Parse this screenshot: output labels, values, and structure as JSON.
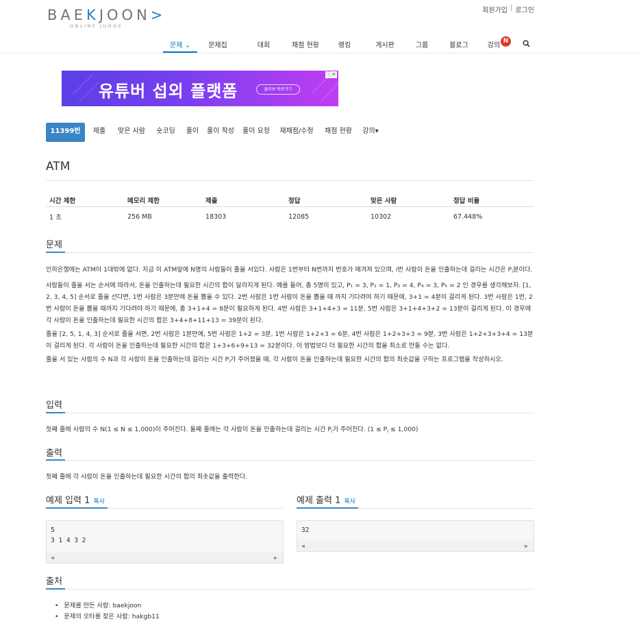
{
  "logo": {
    "main_pre": "BAE",
    "main_k": "K",
    "main_post": "JOON",
    "main_arrow": ">",
    "sub": "ONLINE JUDGE"
  },
  "top_links": {
    "signup": "회원가입",
    "separator": "|",
    "login": "로그인"
  },
  "nav": {
    "items": [
      {
        "label": "문제 ⌄",
        "active": true
      },
      {
        "label": "문제집"
      },
      {
        "label": "대회"
      },
      {
        "label": "채점 현황"
      },
      {
        "label": "랭킹"
      },
      {
        "label": "게시판"
      },
      {
        "label": "그룹"
      },
      {
        "label": "블로그"
      },
      {
        "label": "강의"
      }
    ],
    "badge": "N",
    "search_icon": "search-icon"
  },
  "ad": {
    "text": "유튜버 섭외 플랫폼",
    "button": "둘러보 바로가기",
    "close": "ⓘ✕"
  },
  "problem_tabs": [
    "11399번",
    "제출",
    "맞은 사람",
    "숏코딩",
    "풀이",
    "풀이 작성",
    "풀이 요청",
    "재채점/수정",
    "채점 현황",
    "강의▾"
  ],
  "problem": {
    "title": "ATM",
    "stats_headers": [
      "시간 제한",
      "메모리 제한",
      "제출",
      "정답",
      "맞은 사람",
      "정답 비율"
    ],
    "stats_values": [
      "1 초",
      "256 MB",
      "18303",
      "12085",
      "10302",
      "67.448%"
    ]
  },
  "sections": {
    "problem_title": "문제",
    "input_title": "입력",
    "output_title": "출력",
    "sample_input_title": "예제 입력 1",
    "sample_output_title": "예제 출력 1",
    "copy": "복사",
    "source_title": "출처"
  },
  "description": {
    "p1a": "인하은행에는 ATM이 1대밖에 없다. 지금 이 ATM앞에 N명의 사람들이 줄을 서있다. 사람은 1번부터 N번까지 번호가 매겨져 있으며, i번 사람이 돈을 인출하는데 걸리는 시간은 P",
    "p1sub": "i",
    "p1b": "분이다.",
    "p2": "사람들이 줄을 서는 순서에 따라서, 돈을 인출하는데 필요한 시간의 합이 달라지게 된다. 예를 들어, 총 5명이 있고, P₁ = 3, P₂ = 1, P₃ = 4, P₄ = 3, P₅ = 2 인 경우를 생각해보자. [1, 2, 3, 4, 5] 순서로 줄을 선다면, 1번 사람은 3분만에 돈을 뽑을 수 있다. 2번 사람은 1번 사람이 돈을 뽑을 때 까지 기다려야 하기 때문에, 3+1 = 4분이 걸리게 된다. 3번 사람은 1번, 2번 사람이 돈을 뽑을 때까지 기다려야 하기 때문에, 총 3+1+4 = 8분이 필요하게 된다. 4번 사람은 3+1+4+3 = 11분, 5번 사람은 3+1+4+3+2 = 13분이 걸리게 된다. 이 경우에 각 사람이 돈을 인출하는데 필요한 시간의 합은 3+4+8+11+13 = 39분이 된다.",
    "p3": "줄을 [2, 5, 1, 4, 3] 순서로 줄을 서면, 2번 사람은 1분만에, 5번 사람은 1+2 = 3분, 1번 사람은 1+2+3 = 6분, 4번 사람은 1+2+3+3 = 9분, 3번 사람은 1+2+3+3+4 = 13분이 걸리게 된다. 각 사람이 돈을 인출하는데 필요한 시간의 합은 1+3+6+9+13 = 32분이다. 이 방법보다 더 필요한 시간의 합을 최소로 만들 수는 없다.",
    "p4a": "줄을 서 있는 사람의 수 N과 각 사람이 돈을 인출하는데 걸리는 시간 P",
    "p4sub": "i",
    "p4b": "가 주어졌을 때, 각 사람이 돈을 인출하는데 필요한 시간의 합의 최솟값을 구하는 프로그램을 작성하시오."
  },
  "input_desc": {
    "a": "첫째 줄에 사람의 수 N(1 ≤ N ≤ 1,000)이 주어진다. 둘째 줄에는 각 사람이 돈을 인출하는데 걸리는 시간 P",
    "sub1": "i",
    "b": "가 주어진다. (1 ≤ P",
    "sub2": "i",
    "c": " ≤ 1,000)"
  },
  "output_desc": "첫째 줄에 각 사람이 돈을 인출하는데 필요한 시간의 합의 최솟값을 출력한다.",
  "sample_input": "5\n3 1 4 3 2",
  "sample_output": "32",
  "source": [
    "문제를 만든 사람: baekjoon",
    "문제의 오타를 찾은 사람: hakgb11"
  ]
}
